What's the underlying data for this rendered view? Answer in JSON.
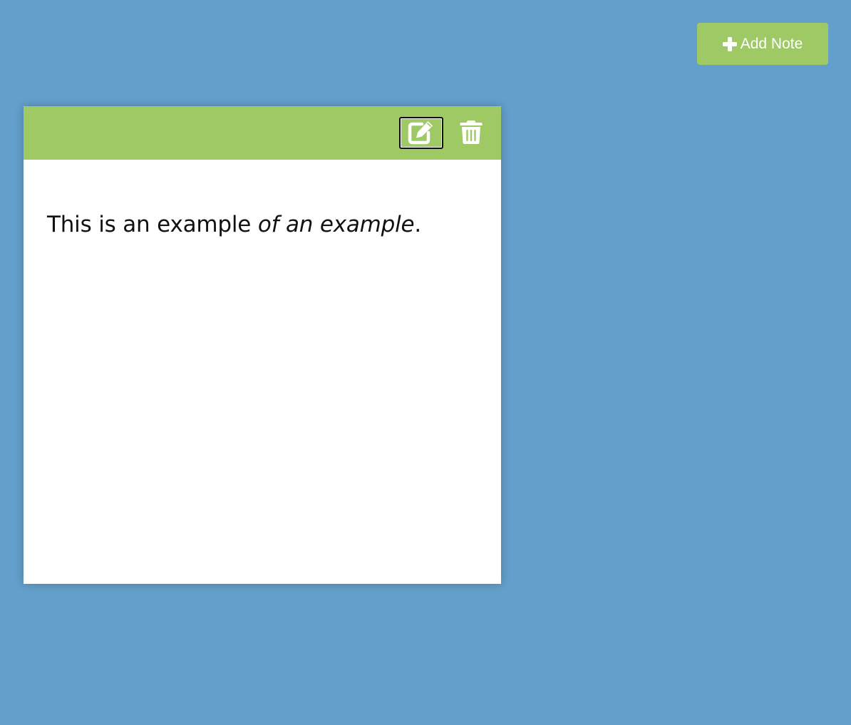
{
  "toolbar": {
    "add_note_label": "Add Note",
    "add_icon": "plus-icon"
  },
  "note": {
    "edit_icon": "edit-icon",
    "delete_icon": "trash-icon",
    "text_plain": "This is an example ",
    "text_italic": "of an example",
    "text_end": "."
  },
  "colors": {
    "background": "#639fca",
    "accent": "#9ec964",
    "note_background": "#ffffff",
    "text": "#111111"
  }
}
